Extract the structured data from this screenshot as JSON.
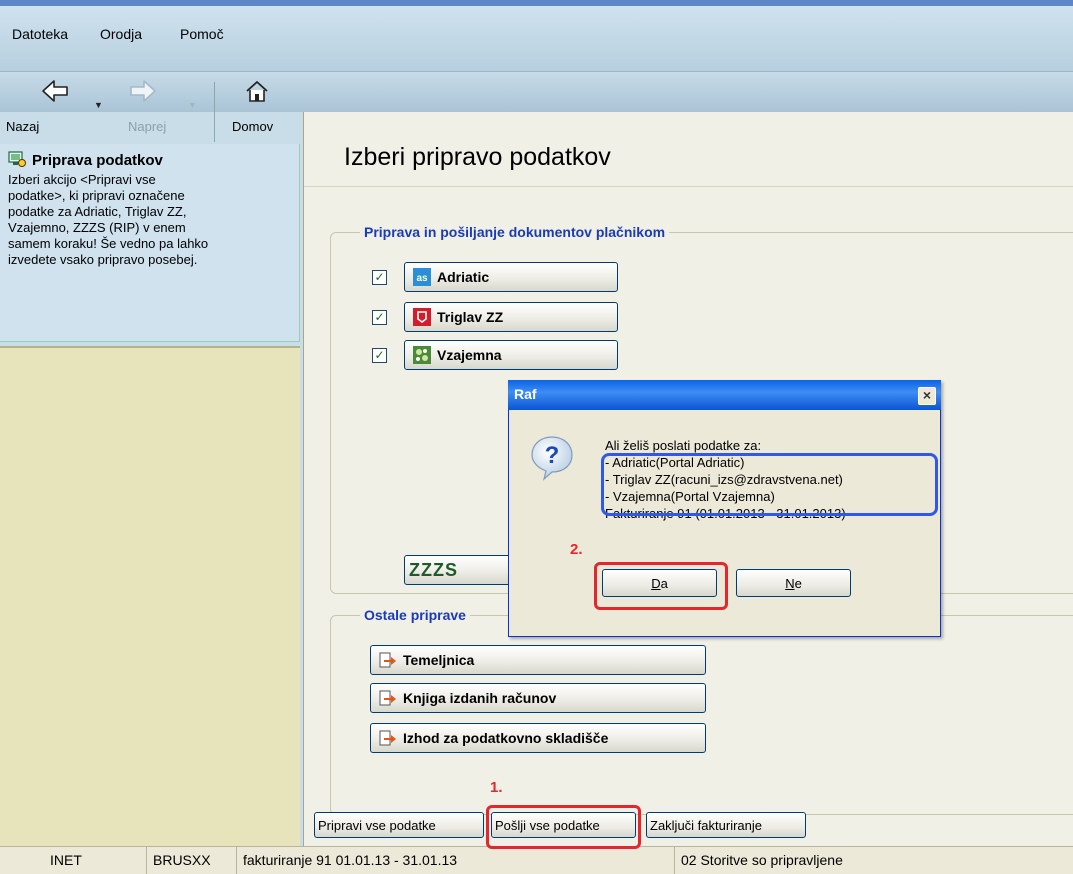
{
  "menu": {
    "items": [
      "Datoteka",
      "Orodja",
      "Pomoč"
    ]
  },
  "toolbar": {
    "back": "Nazaj",
    "forward": "Naprej",
    "home": "Domov"
  },
  "info": {
    "title": "Priprava podatkov",
    "lines": [
      "Izberi akcijo <Pripravi vse",
      "podatke>, ki pripravi označene",
      "podatke za Adriatic, Triglav ZZ,",
      "Vzajemno, ZZZS (RIP) v enem",
      "samem koraku! Še vedno pa lahko",
      "izvedete vsako pripravo posebej."
    ]
  },
  "main": {
    "title": "Izberi pripravo podatkov",
    "group1_title": "Priprava in pošiljanje dokumentov plačnikom",
    "payers": [
      {
        "label": "Adriatic",
        "icon": "adriatic-logo-icon",
        "checked": true
      },
      {
        "label": "Triglav ZZ",
        "icon": "triglav-logo-icon",
        "checked": true
      },
      {
        "label": "Vzajemna",
        "icon": "vzajemna-logo-icon",
        "checked": true
      }
    ],
    "zzzs_partial": "ZZZS",
    "group2_title": "Ostale priprave",
    "others": [
      {
        "label": "Temeljnica",
        "icon": "export-arrow-icon"
      },
      {
        "label": "Knjiga izdanih računov",
        "icon": "export-arrow-icon"
      },
      {
        "label": "Izhod za podatkovno skladišče",
        "icon": "export-arrow-icon"
      }
    ]
  },
  "bottom": {
    "prepare_all": "Pripravi vse podatke",
    "send_all": "Pošlji vse podatke",
    "finish": "Zaključi fakturiranje"
  },
  "status": {
    "cells": [
      "INET",
      "BRUSXX",
      "fakturiranje 91  01.01.13 - 31.01.13",
      "02 Storitve so pripravljene"
    ]
  },
  "dialog": {
    "title": "Raf",
    "question": "Ali želiš poslati podatke za:",
    "items": [
      "- Adriatic(Portal Adriatic)",
      "- Triglav ZZ(racuni_izs@zdravstvena.net)",
      "- Vzajemna(Portal Vzajemna)"
    ],
    "footer": "Fakturiranje 91 (01.01.2013 - 31.01.2013)",
    "yes_mnemonic": "D",
    "yes_rest": "a",
    "no_mnemonic": "N",
    "no_rest": "e"
  },
  "annotations": {
    "step1": "1.",
    "step2": "2."
  },
  "colors": {
    "highlight_red": "#e5262c",
    "highlight_blue": "#2f5ae8",
    "group_title": "#1a3bb8"
  }
}
